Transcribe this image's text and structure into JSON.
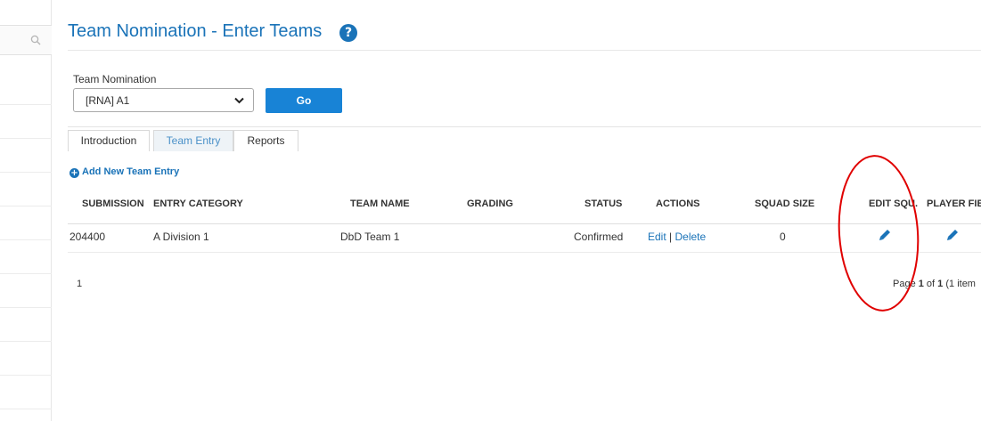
{
  "page": {
    "title": "Team Nomination - Enter Teams"
  },
  "form": {
    "label": "Team Nomination",
    "selected": "[RNA] A1",
    "go_label": "Go"
  },
  "tabs": [
    {
      "label": "Introduction",
      "active": false
    },
    {
      "label": "Team Entry",
      "active": true
    },
    {
      "label": "Reports",
      "active": false
    }
  ],
  "add_entry_label": "Add New Team Entry",
  "table": {
    "columns": [
      "SUBMISSION",
      "ENTRY CATEGORY",
      "TEAM NAME",
      "GRADING",
      "STATUS",
      "ACTIONS",
      "SQUAD SIZE",
      "EDIT SQU.",
      "PLAYER FIELD"
    ],
    "rows": [
      {
        "submission": "204400",
        "category": "A Division 1",
        "team_name": "DbD Team 1",
        "grading": "",
        "status": "Confirmed",
        "edit": "Edit",
        "separator": "|",
        "delete": "Delete",
        "squad_size": "0"
      }
    ]
  },
  "pager": {
    "current": "1",
    "prefix": "Page ",
    "page": "1",
    "of": " of ",
    "total": "1",
    "suffix": " (1 item"
  },
  "colors": {
    "accent": "#1a73b8",
    "button": "#1883d6",
    "annotation": "#e00000"
  }
}
